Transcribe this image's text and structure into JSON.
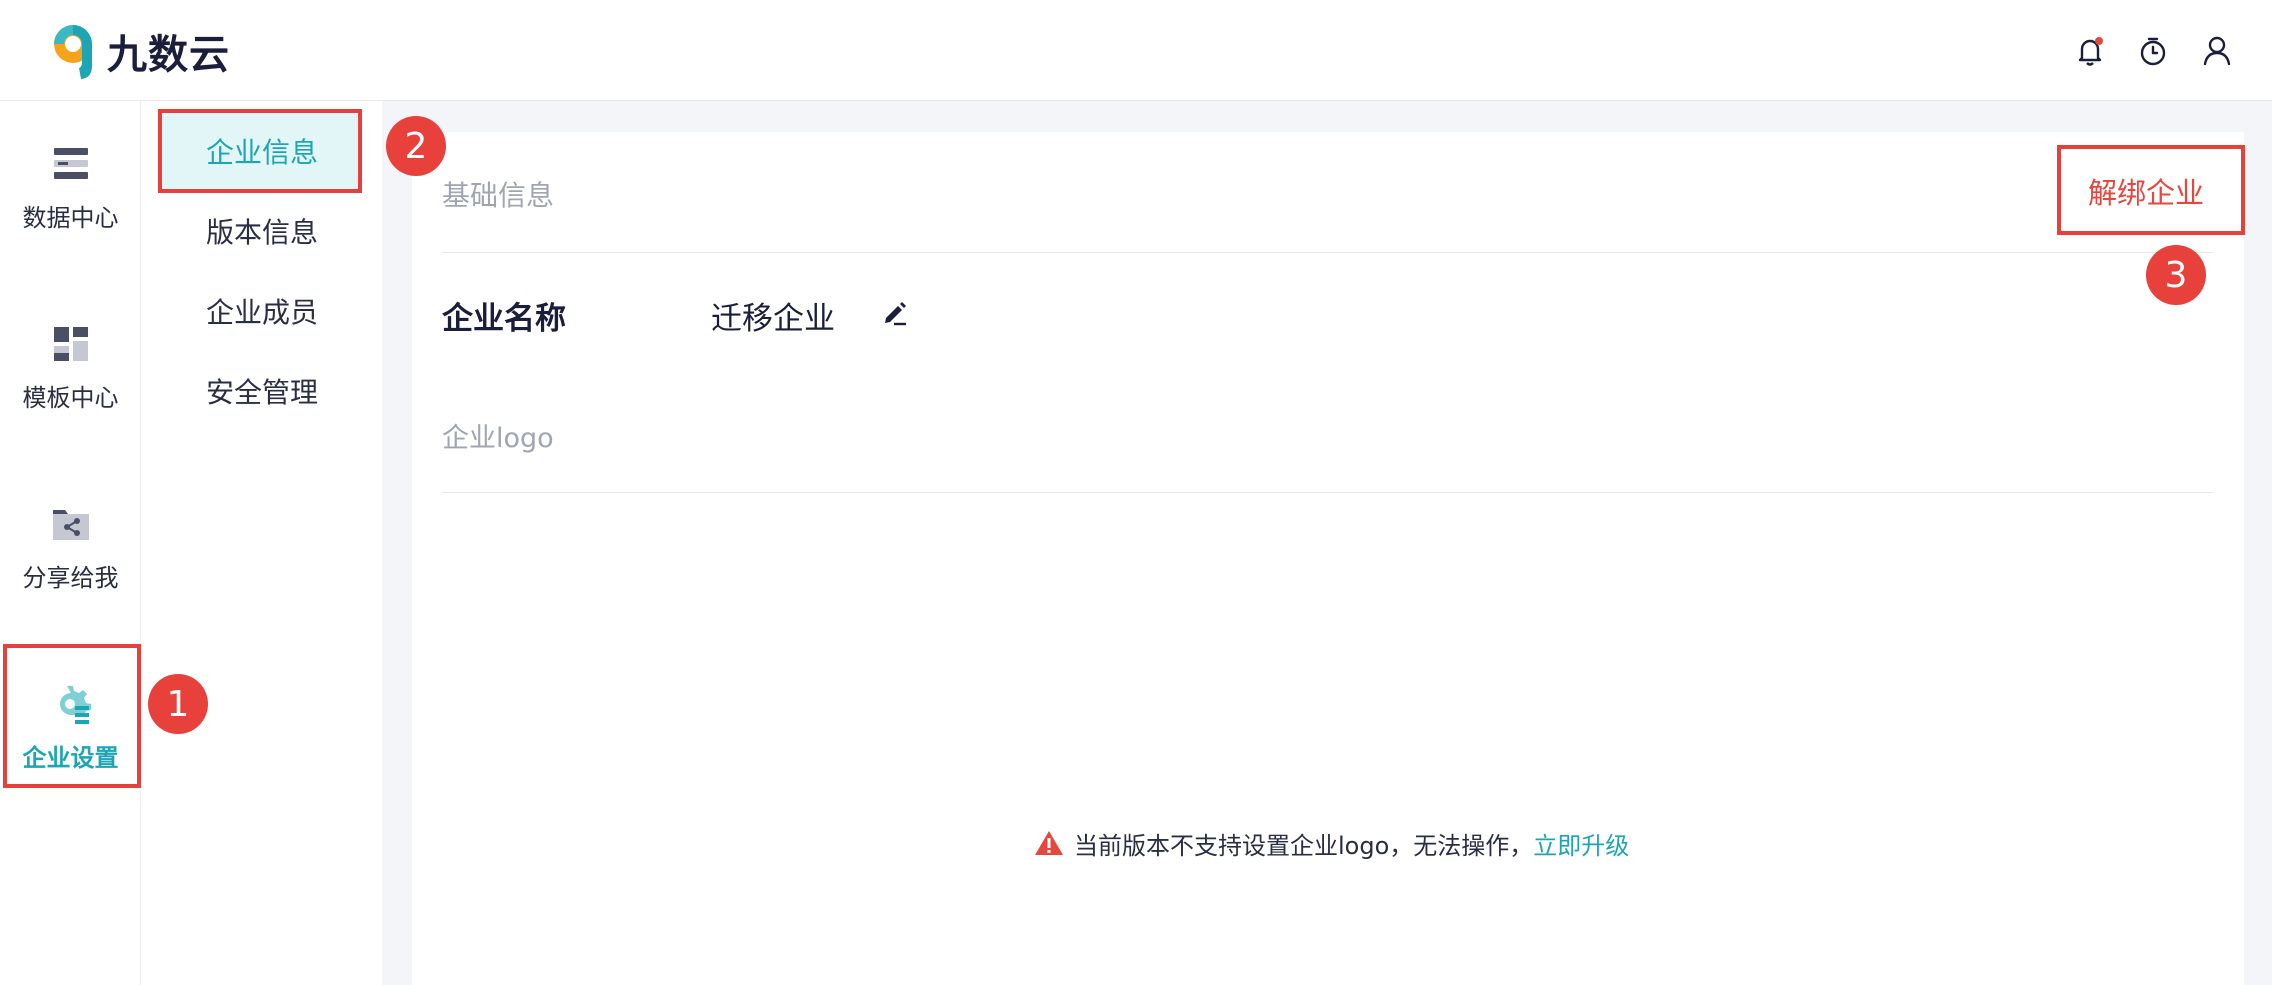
{
  "header": {
    "brand": "九数云",
    "icons": [
      "bell-icon",
      "timer-icon",
      "user-icon"
    ],
    "notification_dot_color": "#e5473f"
  },
  "nav": {
    "items": [
      {
        "label": "数据中心",
        "icon": "data-center-icon"
      },
      {
        "label": "模板中心",
        "icon": "template-center-icon"
      },
      {
        "label": "分享给我",
        "icon": "shared-with-me-icon"
      },
      {
        "label": "企业设置",
        "icon": "enterprise-settings-icon",
        "active": true
      }
    ]
  },
  "subnav": {
    "items": [
      {
        "label": "企业信息",
        "active": true
      },
      {
        "label": "版本信息"
      },
      {
        "label": "企业成员"
      },
      {
        "label": "安全管理"
      }
    ]
  },
  "main": {
    "section_title": "基础信息",
    "unbind_label": "解绑企业",
    "name_label": "企业名称",
    "name_value": "迁移企业",
    "logo_label": "企业logo",
    "notice_text": "当前版本不支持设置企业logo，无法操作，",
    "upgrade_link": "立即升级"
  },
  "annotations": [
    "1",
    "2",
    "3"
  ],
  "colors": {
    "accent": "#1ea5b3",
    "danger": "#e5473f",
    "annotation": "#e8403a"
  }
}
